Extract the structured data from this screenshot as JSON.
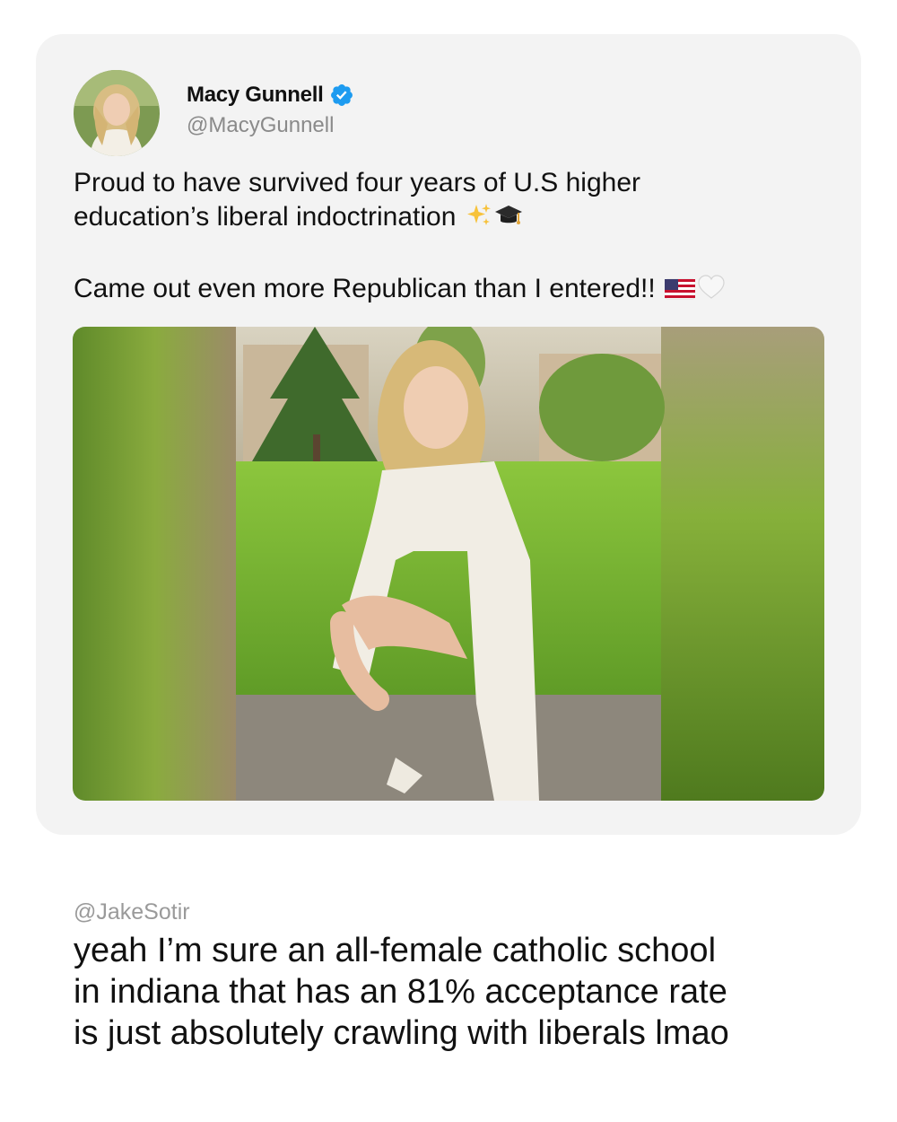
{
  "tweet": {
    "display_name": "Macy Gunnell",
    "handle": "@MacyGunnell",
    "verified": true,
    "text_line1": "Proud to have survived four years of U.S higher",
    "text_line2": "education’s liberal indoctrination",
    "text_line3": "Came out even more Republican than I entered!!",
    "emojis": [
      "sparkles-icon",
      "graduation-cap-icon",
      "us-flag-icon",
      "white-heart-icon"
    ],
    "accent_color": "#1d9bf0"
  },
  "reply": {
    "handle": "@JakeSotir",
    "lines": [
      "yeah I’m sure an all-female catholic school",
      "in indiana that has an 81% acceptance rate",
      "is just absolutely crawling with liberals lmao"
    ]
  }
}
